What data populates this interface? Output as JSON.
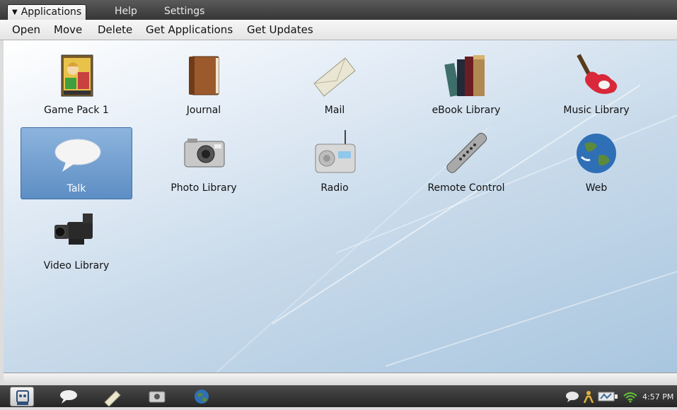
{
  "menu": {
    "tabs": [
      {
        "label": "Applications"
      },
      {
        "label": "Help"
      },
      {
        "label": "Settings"
      }
    ]
  },
  "toolbar": {
    "open": "Open",
    "move": "Move",
    "delete": "Delete",
    "get_applications": "Get Applications",
    "get_updates": "Get Updates"
  },
  "apps": [
    {
      "label": "Game Pack 1",
      "icon": "game-pack-icon"
    },
    {
      "label": "Journal",
      "icon": "journal-icon"
    },
    {
      "label": "Mail",
      "icon": "mail-icon"
    },
    {
      "label": "eBook Library",
      "icon": "ebook-library-icon"
    },
    {
      "label": "Music Library",
      "icon": "guitar-icon"
    },
    {
      "label": "Talk",
      "icon": "speech-bubble-icon",
      "selected": true
    },
    {
      "label": "Photo Library",
      "icon": "camera-icon"
    },
    {
      "label": "Radio",
      "icon": "radio-icon"
    },
    {
      "label": "Remote Control",
      "icon": "remote-control-icon"
    },
    {
      "label": "Web",
      "icon": "globe-icon"
    },
    {
      "label": "Video Library",
      "icon": "video-camera-icon"
    }
  ],
  "taskbar": {
    "items": [
      "home-icon",
      "speech-bubble-icon",
      "journal-icon",
      "camera-icon",
      "globe-icon"
    ],
    "tray": [
      "chat-icon",
      "network-user-icon",
      "battery-icon",
      "wifi-icon"
    ],
    "clock": "4:57 PM"
  },
  "colors": {
    "selection": "#5d8ec4",
    "top_bar": "#3c3c3c",
    "desktop": "#c8daea"
  }
}
